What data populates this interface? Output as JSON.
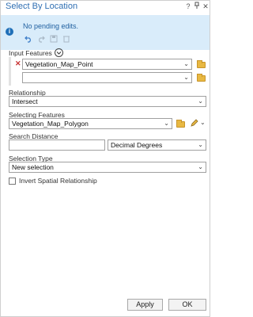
{
  "window": {
    "title": "Select By Location",
    "help_icon": "?",
    "pin_icon": "pin-icon",
    "close_icon": "✕"
  },
  "info": {
    "message": "No pending edits.",
    "info_icon": "i",
    "toolbar": [
      "undo-icon",
      "redo-icon",
      "save-icon",
      "discard-icon"
    ]
  },
  "input_features": {
    "label": "Input Features",
    "add_icon": "chevron-down-icon",
    "rows": [
      {
        "value": "Vegetation_Map_Point"
      },
      {
        "value": ""
      }
    ]
  },
  "relationship": {
    "label": "Relationship",
    "value": "Intersect"
  },
  "selecting_features": {
    "label": "Selecting Features",
    "value": "Vegetation_Map_Polygon"
  },
  "search_distance": {
    "label": "Search Distance",
    "value": "",
    "unit": "Decimal Degrees"
  },
  "selection_type": {
    "label": "Selection Type",
    "value": "New selection"
  },
  "invert": {
    "label": "Invert Spatial Relationship",
    "checked": false
  },
  "buttons": {
    "apply": "Apply",
    "ok": "OK"
  }
}
